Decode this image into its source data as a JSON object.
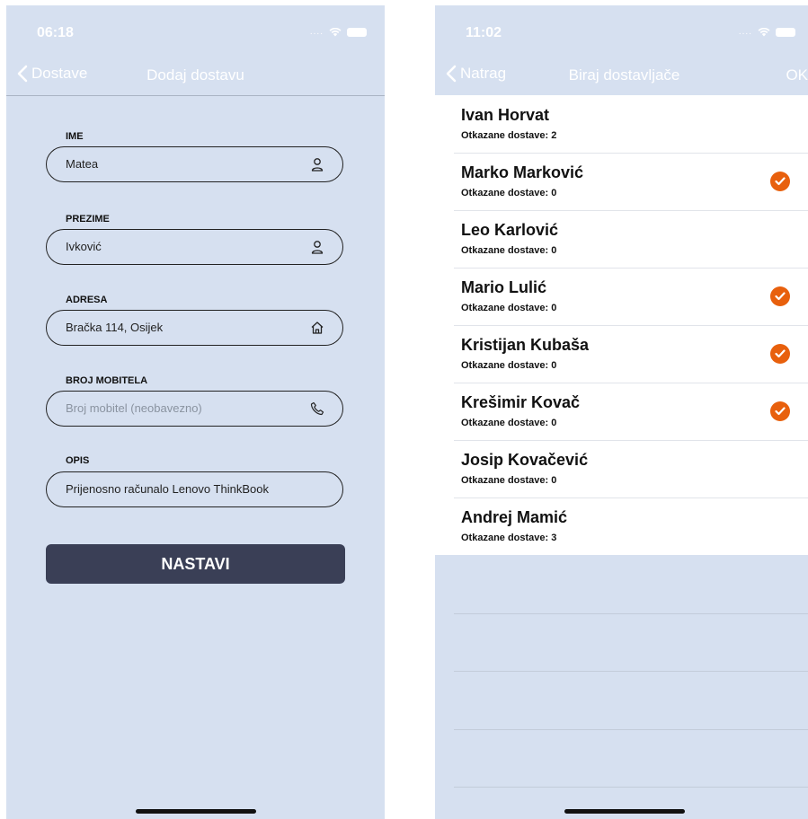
{
  "left": {
    "status": {
      "time": "06:18"
    },
    "nav": {
      "back_label": "Dostave",
      "title": "Dodaj dostavu"
    },
    "form": {
      "ime": {
        "label": "IME",
        "value": "Matea"
      },
      "prezime": {
        "label": "PREZIME",
        "value": "Ivković"
      },
      "adresa": {
        "label": "ADRESA",
        "value": "Bračka 114, Osijek"
      },
      "broj": {
        "label": "BROJ MOBITELA",
        "placeholder": "Broj mobitel (neobavezno)"
      },
      "opis": {
        "label": "OPIS",
        "value": "Prijenosno računalo Lenovo ThinkBook"
      }
    },
    "submit_label": "NASTAVI"
  },
  "right": {
    "status": {
      "time": "11:02"
    },
    "nav": {
      "back_label": "Natrag",
      "title": "Biraj dostavljače",
      "ok_label": "OK"
    },
    "couriers": [
      {
        "name": "Ivan Horvat",
        "sub": "Otkazane dostave: 2",
        "selected": false
      },
      {
        "name": "Marko Marković",
        "sub": "Otkazane dostave: 0",
        "selected": true
      },
      {
        "name": "Leo Karlović",
        "sub": "Otkazane dostave: 0",
        "selected": false
      },
      {
        "name": "Mario Lulić",
        "sub": "Otkazane dostave: 0",
        "selected": true
      },
      {
        "name": "Kristijan Kubaša",
        "sub": "Otkazane dostave: 0",
        "selected": true
      },
      {
        "name": "Krešimir Kovač",
        "sub": "Otkazane dostave: 0",
        "selected": true
      },
      {
        "name": "Josip Kovačević",
        "sub": "Otkazane dostave: 0",
        "selected": false
      },
      {
        "name": "Andrej Mamić",
        "sub": "Otkazane dostave: 3",
        "selected": false
      }
    ]
  },
  "colors": {
    "background": "#d6e0f0",
    "button": "#3a3f56",
    "accent_check": "#e8600d"
  },
  "icons": [
    "chevron-left-icon",
    "person-icon",
    "home-icon",
    "phone-icon",
    "checkmark-icon",
    "wifi-icon",
    "battery-icon"
  ]
}
